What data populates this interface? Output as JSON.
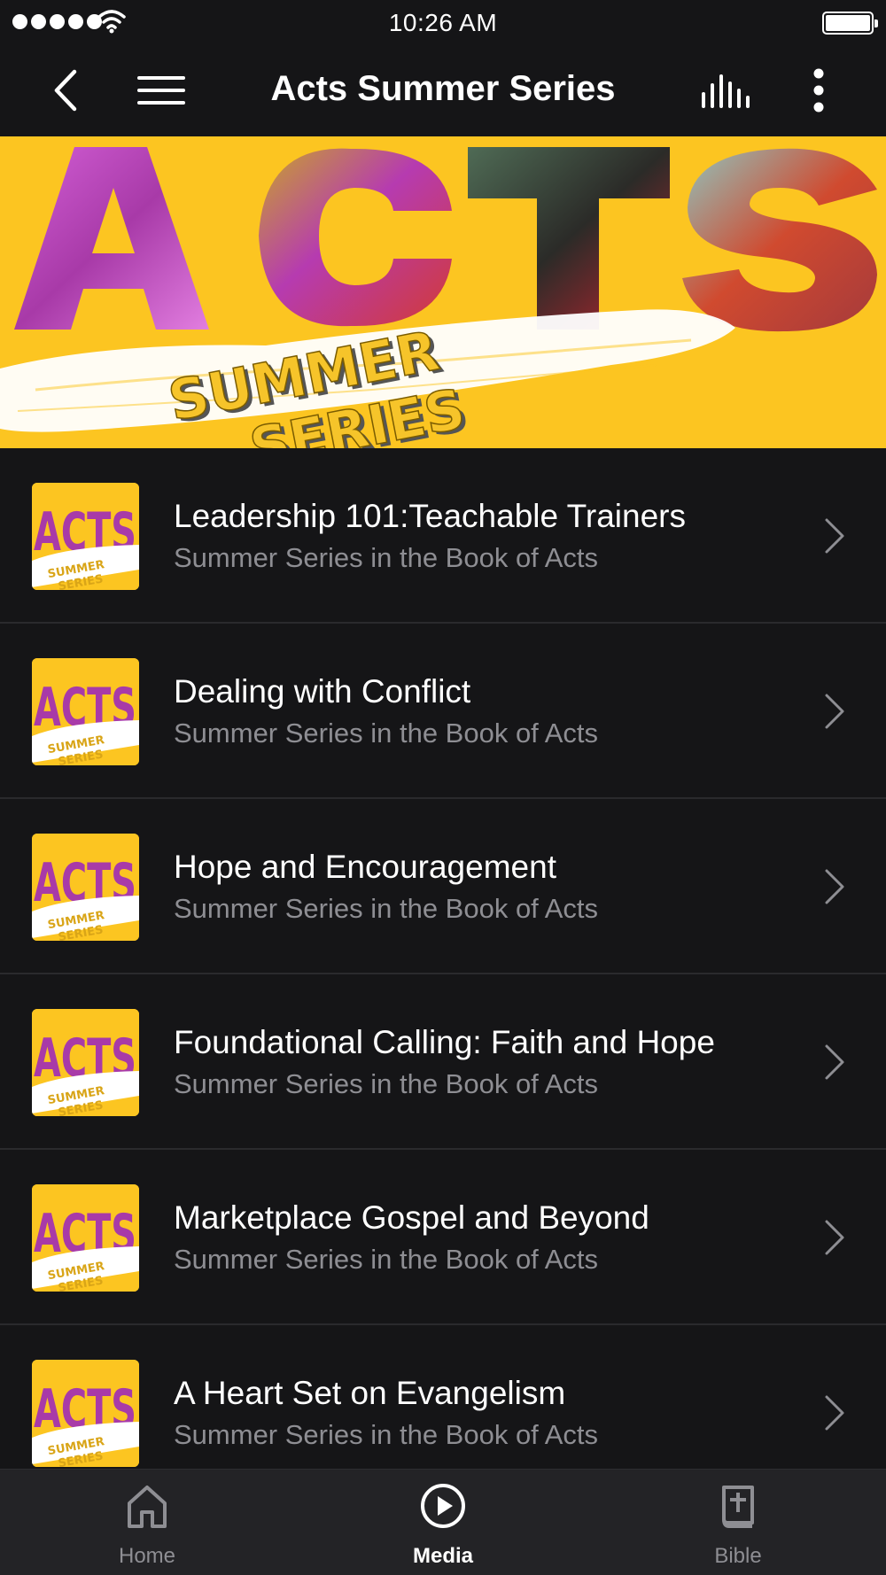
{
  "status_bar": {
    "time": "10:26 AM"
  },
  "nav": {
    "title": "Acts Summer Series",
    "icons": [
      "back-chevron-icon",
      "hamburger-menu-icon",
      "audio-bars-icon",
      "more-vertical-icon"
    ]
  },
  "banner": {
    "headline": "ACTS",
    "tagline_line1": "SUMMER",
    "tagline_line2": "SERIES",
    "background_color": "#fcc521"
  },
  "items": [
    {
      "title": "Leadership 101:Teachable Trainers",
      "subtitle": "Summer Series in the Book of Acts"
    },
    {
      "title": "Dealing with Conflict",
      "subtitle": "Summer Series in the Book of Acts"
    },
    {
      "title": "Hope and Encouragement",
      "subtitle": "Summer Series in the Book of Acts"
    },
    {
      "title": "Foundational Calling: Faith and Hope",
      "subtitle": "Summer Series in the Book of Acts"
    },
    {
      "title": "Marketplace Gospel and Beyond",
      "subtitle": "Summer Series in the Book of Acts"
    },
    {
      "title": "A Heart Set on Evangelism",
      "subtitle": "Summer Series in the Book of Acts"
    }
  ],
  "tabs": [
    {
      "label": "Home",
      "icon": "home-icon",
      "active": false
    },
    {
      "label": "Media",
      "icon": "play-circle-icon",
      "active": true
    },
    {
      "label": "Bible",
      "icon": "bible-icon",
      "active": false
    }
  ],
  "colors": {
    "background": "#151517",
    "accent_yellow": "#fcc521",
    "subtitle_gray": "#8e8e93",
    "tab_bar": "#232326"
  }
}
